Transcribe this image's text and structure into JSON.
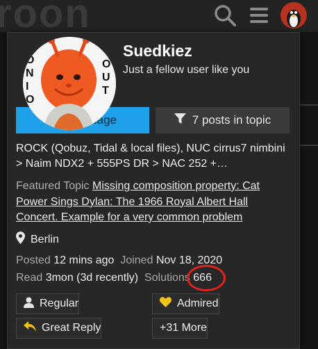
{
  "header": {
    "logo_text": "roon",
    "search_icon": "search-icon",
    "menu_icon": "hamburger-menu-icon",
    "avatar_icon": "user-avatar"
  },
  "card": {
    "avatar_sign_left": "ONIO",
    "avatar_sign_right": "OUT",
    "username": "Suedkiez",
    "tagline": "Just a fellow user like you",
    "message_label": "Message",
    "posts_label": "7 posts in topic",
    "bio": "ROCK (Qobuz, Tidal & local files), NUC cirrus7 nimbini > Naim NDX2 + 555PS DR > NAC 252 +…",
    "featured_label": "Featured Topic",
    "featured_title": "Missing composition property: Cat Power Sings Dylan: The 1966 Royal Albert Hall Concert. Example for a very common problem",
    "location": "Berlin",
    "posted_label": "Posted",
    "posted_value": "12 mins ago",
    "joined_label": "Joined",
    "joined_value": "Nov 18, 2020",
    "read_label": "Read",
    "read_value": "3mon (3d recently)",
    "solutions_label": "Solutions",
    "solutions_value": "666",
    "badges": [
      {
        "label": "Regular",
        "icon": "user-icon"
      },
      {
        "label": "Admired",
        "icon": "heart-icon"
      },
      {
        "label": "Great Reply",
        "icon": "reply-icon"
      },
      {
        "label": "+31 More",
        "icon": ""
      }
    ]
  },
  "colors": {
    "accent": "#1ea1e8",
    "highlight_circle": "#e0231c",
    "admired_heart": "#f3c316",
    "reply_arrow": "#f3c316"
  }
}
